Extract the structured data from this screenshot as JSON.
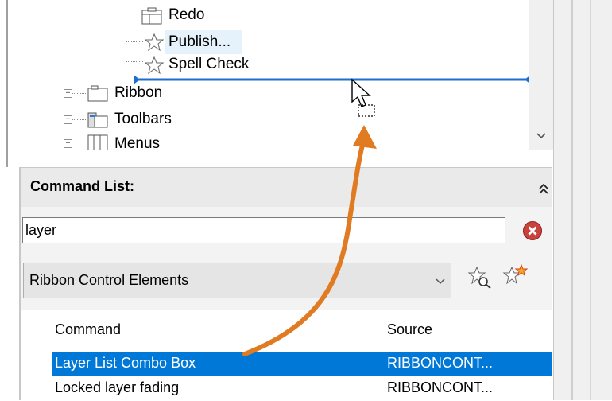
{
  "tree": {
    "items": [
      {
        "label": "Redo",
        "icon": "menu-panel-icon"
      },
      {
        "label": "Publish...",
        "icon": "star-icon"
      },
      {
        "label": "Spell Check",
        "icon": "star-icon"
      },
      {
        "label": "Ribbon",
        "icon": "ribbon-panel-icon"
      },
      {
        "label": "Toolbars",
        "icon": "toolbar-icon"
      },
      {
        "label": "Menus",
        "icon": "menu-icon"
      }
    ]
  },
  "command_list": {
    "title": "Command List:",
    "search": {
      "value": "layer",
      "placeholder": ""
    },
    "filter": {
      "selected": "Ribbon Control Elements"
    },
    "columns": [
      "Command",
      "Source"
    ],
    "rows": [
      {
        "command": "Layer List Combo Box",
        "source": "RIBBONCONT...",
        "selected": true
      },
      {
        "command": "Locked layer fading",
        "source": "RIBBONCONT...",
        "selected": false
      }
    ]
  },
  "colors": {
    "accent": "#0078d7",
    "drag_arrow": "#e07b22",
    "insert_line": "#1c6fd1",
    "clear_icon": "#c9423c"
  }
}
